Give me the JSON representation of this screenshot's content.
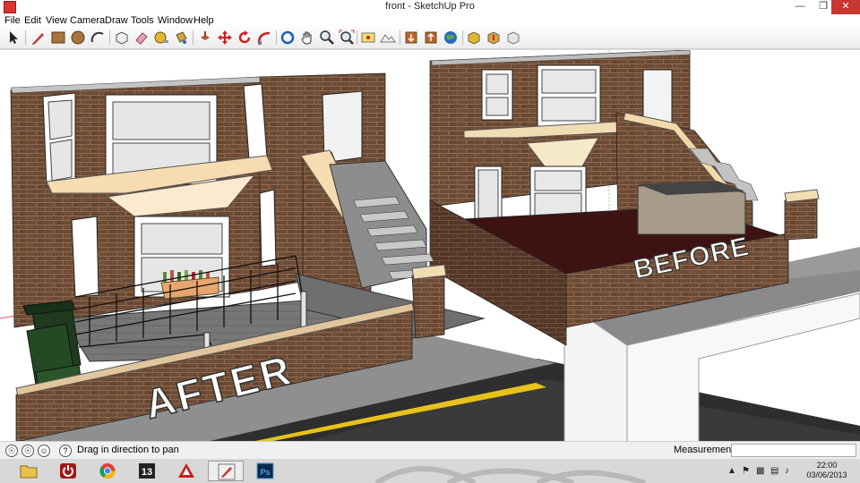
{
  "window": {
    "title": "front - SketchUp Pro"
  },
  "menu": [
    "File",
    "Edit",
    "View",
    "Camera",
    "Draw",
    "Tools",
    "Window",
    "Help"
  ],
  "toolbar": {
    "tools": [
      "select-tool",
      "pencil-line-tool",
      "rectangle-tool",
      "circle-tool",
      "arc-tool",
      "make-component-tool",
      "eraser-tool",
      "paint-bucket-tool",
      "tape-measure-tool",
      "push-pull-tool",
      "move-tool",
      "rotate-tool",
      "follow-me-tool",
      "orbit-tool",
      "pan-tool",
      "zoom-tool",
      "zoom-extents-tool",
      "add-location-tool",
      "toggle-terrain-tool",
      "get-models-tool",
      "share-model-tool",
      "preview-google-earth-tool",
      "get-photo-texture-tool",
      "share-component-tool",
      "extension-warehouse-tool"
    ]
  },
  "viewport": {
    "label_after": "AFTER",
    "label_before": "BEFORE"
  },
  "status": {
    "hint": "Drag in direction to pan",
    "measurements_label": "Measurements",
    "measurements_value": ""
  },
  "taskbar": {
    "apps": [
      "file-explorer",
      "shutdown-app",
      "chrome",
      "app-13",
      "autocad",
      "sketchup",
      "photoshop"
    ],
    "active_app": "sketchup",
    "time": "22:00",
    "date": "03/06/2013"
  },
  "colors": {
    "close_button": "#c7372f",
    "taskbar": "#d6d6d6",
    "brick": "#6e4b34",
    "render_text": "#ffffff"
  }
}
